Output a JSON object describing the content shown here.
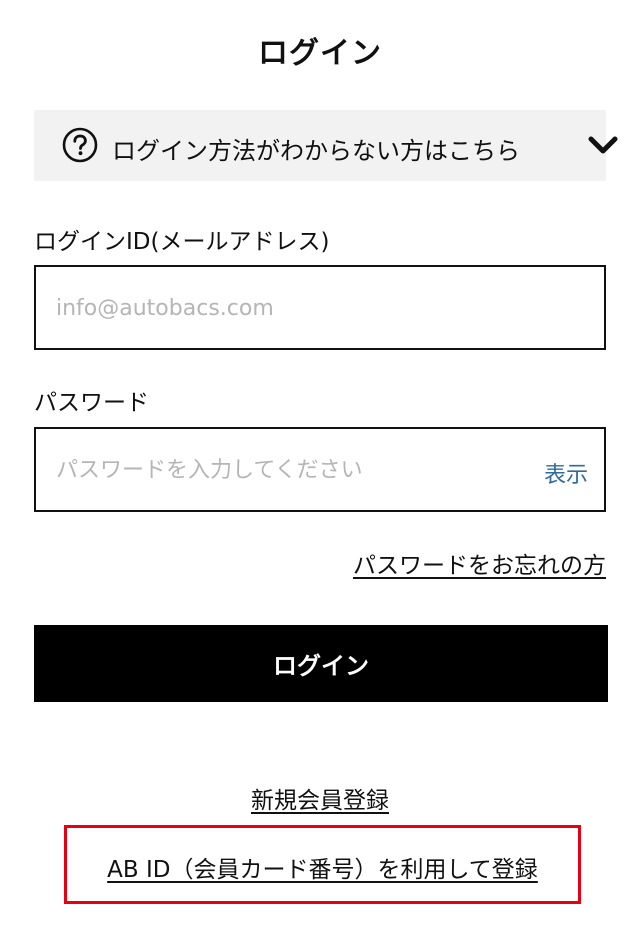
{
  "header": {
    "title": "ログイン"
  },
  "help": {
    "label": "ログイン方法がわからない方はこちら",
    "icon": "question-circle-icon",
    "chevron": "chevron-down-icon"
  },
  "login_id": {
    "label": "ログインID(メールアドレス)",
    "placeholder": "info@autobacs.com",
    "value": ""
  },
  "password": {
    "label": "パスワード",
    "placeholder": "パスワードを入力してください",
    "value": "",
    "show_label": "表示"
  },
  "forgot_password": "パスワードをお忘れの方",
  "login_button": "ログイン",
  "register_link": "新規会員登録",
  "abid_link": "AB ID（会員カード番号）を利用して登録",
  "colors": {
    "highlight_border": "#e60012",
    "show_toggle": "#2d6a9f",
    "button_bg": "#000000",
    "help_bg": "#f2f2f2"
  }
}
